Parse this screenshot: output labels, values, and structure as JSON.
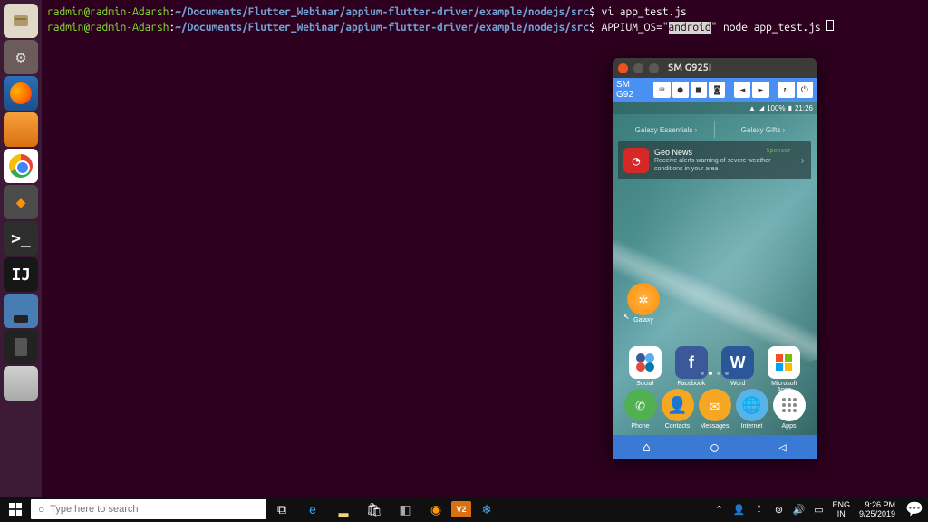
{
  "terminal": {
    "user": "radmin",
    "host": "radmin-Adarsh",
    "path": "~/Documents/Flutter_Webinar/appium-flutter-driver/example/nodejs/src",
    "line1_cmd": "vi app_test.js",
    "line2_env": "APPIUM_OS=",
    "line2_envval": "android",
    "line2_cmd": " node app_test.js "
  },
  "launcher": {
    "items": [
      {
        "name": "files"
      },
      {
        "name": "settings"
      },
      {
        "name": "firefox"
      },
      {
        "name": "app5"
      },
      {
        "name": "chrome"
      },
      {
        "name": "sublime"
      },
      {
        "name": "terminal"
      },
      {
        "name": "intellij"
      },
      {
        "name": "app10"
      },
      {
        "name": "app11"
      },
      {
        "name": "app12"
      }
    ]
  },
  "phone": {
    "window_title": "SM G925I",
    "device_label": "SM G92",
    "status": {
      "battery": "100%",
      "time": "21:26"
    },
    "tabs": [
      "Galaxy Essentials  ›",
      "Galaxy Gifts  ›"
    ],
    "card": {
      "title": "Geo News",
      "subtitle": "Receive alerts warning of severe weather conditions in your area",
      "sponsor": "Sponsor"
    },
    "galaxy_label": "Galaxy",
    "apps_row1": [
      {
        "label": "Social"
      },
      {
        "label": "Facebook"
      },
      {
        "label": "Word"
      },
      {
        "label": "Microsoft Apps"
      }
    ],
    "dock": [
      {
        "label": "Phone"
      },
      {
        "label": "Contacts"
      },
      {
        "label": "Messages"
      },
      {
        "label": "Internet"
      },
      {
        "label": "Apps"
      }
    ]
  },
  "taskbar": {
    "search_placeholder": "Type here to search",
    "lang": {
      "top": "ENG",
      "bottom": "IN"
    },
    "clock": {
      "time": "9:26 PM",
      "date": "9/25/2019"
    }
  }
}
